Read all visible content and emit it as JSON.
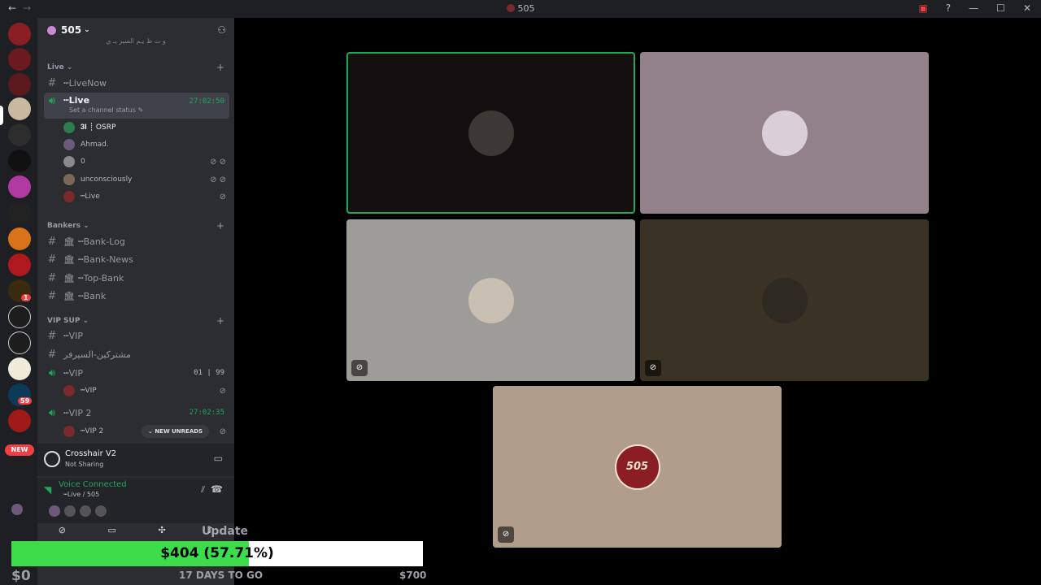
{
  "window": {
    "title": "505"
  },
  "server": {
    "name": "505",
    "header_overflow": "و ت  ظ يـم  السير يـ ي"
  },
  "categories": {
    "live": "Live",
    "bankers": "Bankers",
    "vip": "VIP SUP"
  },
  "channels": {
    "livenow": "┅LiveNow",
    "live": "┅Live",
    "live_status": "Set a channel status",
    "live_time": "27:02:50",
    "bank_log": "┅Bank-Log",
    "bank_news": "┅Bank-News",
    "top_bank": "┅Top-Bank",
    "bank": "┅Bank",
    "vip_text": "┅VIP",
    "vip_arabic": "مشتركين-السيرفر",
    "vip_voice": "┅VIP",
    "vip_counts": "01 | 99",
    "vip2": "┅VIP 2",
    "vip2_time": "27:02:35"
  },
  "voice_users": [
    {
      "name": "𝟑𝐈 ┊ OSRP",
      "color": "#2e7d4f"
    },
    {
      "name": "Ahmad.",
      "color": "#6b5a7a"
    },
    {
      "name": "0",
      "color": "#8a8a8a"
    },
    {
      "name": "unconsciously",
      "color": "#7a6a55"
    },
    {
      "name": "┅Live",
      "color": "#7a2a2a"
    }
  ],
  "vip_users": [
    {
      "name": "┅VIP",
      "color": "#7a2a2a"
    },
    {
      "name": "┅VIP 2",
      "color": "#7a2a2a"
    }
  ],
  "new_unreads": "NEW UNREADS",
  "new_badge": "NEW",
  "guild_badges": [
    "1",
    "59"
  ],
  "activity": {
    "title": "Crosshair V2",
    "status": "Not Sharing"
  },
  "voice": {
    "status": "Voice Connected",
    "channel": "┅Live / 505"
  },
  "overlay": {
    "update_text": "Update",
    "progress_label": "$404 (57.71%)",
    "progress_fraction": 0.5771,
    "left_amount": "$0",
    "days": "17 DAYS TO GO",
    "goal": "$700"
  },
  "tiles": [
    {
      "bg": "#141011",
      "avatar": "#3b3836",
      "speaking": true
    },
    {
      "bg": "#938189",
      "avatar": "#d9cfd8",
      "speaking": false
    },
    {
      "bg": "#9e9c99",
      "avatar": "#c9bfb2",
      "speaking": false
    },
    {
      "bg": "#3a3224",
      "avatar": "#2e2a22",
      "speaking": false
    },
    {
      "bg": "#b09e8a",
      "avatar": "#8b1e24",
      "speaking": false,
      "avatar_text": "505"
    }
  ]
}
